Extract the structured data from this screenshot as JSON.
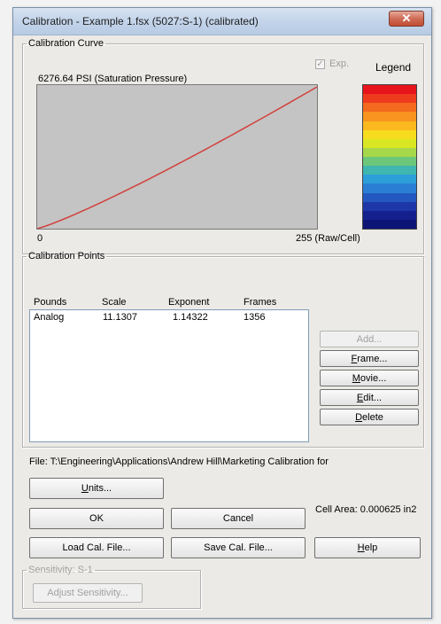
{
  "window": {
    "title": "Calibration - Example 1.fsx (5027:S-1) (calibrated)",
    "close_glyph": "✕"
  },
  "curve_group": {
    "title": "Calibration Curve",
    "top_label": "6276.64 PSI (Saturation Pressure)",
    "x_min_label": "0",
    "x_max_label": "255 (Raw/Cell)",
    "exp_label": "Exp.",
    "exp_checked": true,
    "legend_title": "Legend",
    "curve_color": "#d2403c",
    "plot_bg": "#c4c4c4",
    "legend_colors": [
      "#e8141c",
      "#ef3b1d",
      "#f46a1e",
      "#f8941f",
      "#fbb91f",
      "#f7dc1e",
      "#d9e623",
      "#a6d84a",
      "#6cc77a",
      "#3fb6b0",
      "#2c9fd9",
      "#2a7fd4",
      "#2358c0",
      "#1d36a8",
      "#15208f",
      "#0c1476"
    ]
  },
  "points_group": {
    "title": "Calibration Points",
    "columns": [
      "Pounds",
      "Scale",
      "Exponent",
      "Frames"
    ],
    "rows": [
      [
        "Analog",
        "11.1307",
        "1.14322",
        "1356"
      ]
    ],
    "buttons": {
      "add": "Add...",
      "frame": "Frame...",
      "movie": "Movie...",
      "edit": "Edit...",
      "delete": "Delete"
    }
  },
  "file_line": "File: T:\\Engineering\\Applications\\Andrew Hill\\Marketing Calibration for",
  "buttons": {
    "units": "Units...",
    "ok": "OK",
    "cancel": "Cancel",
    "load": "Load Cal. File...",
    "save": "Save Cal. File...",
    "help": "Help"
  },
  "cell_area": "Cell Area: 0.000625 in2",
  "sensitivity": {
    "title": "Sensitivity: S-1",
    "adjust": "Adjust Sensitivity..."
  }
}
